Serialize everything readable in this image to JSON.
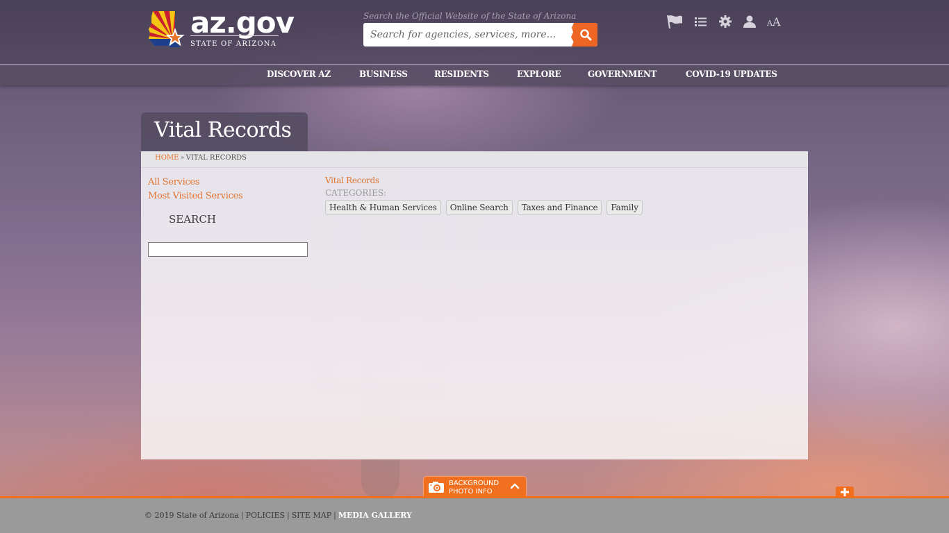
{
  "header": {
    "logo_word": "az.gov",
    "logo_subtitle": "STATE OF ARIZONA",
    "search_label": "Search the Official Website of the State of Arizona",
    "search_placeholder": "Search for agencies, services, more...",
    "search_value": "",
    "utility_icons": [
      "flag-icon",
      "list-icon",
      "gear-icon",
      "user-icon",
      "font-size-icon"
    ],
    "font_size_small": "A",
    "font_size_large": "A"
  },
  "nav": {
    "items": [
      {
        "label": "DISCOVER AZ"
      },
      {
        "label": "BUSINESS"
      },
      {
        "label": "RESIDENTS"
      },
      {
        "label": "EXPLORE"
      },
      {
        "label": "GOVERNMENT"
      },
      {
        "label": "COVID-19 UPDATES"
      }
    ]
  },
  "page": {
    "title": "Vital Records",
    "breadcrumb": {
      "home": "HOME",
      "separator": "»",
      "current": "VITAL RECORDS"
    }
  },
  "sidebar": {
    "links": [
      {
        "label": "All Services"
      },
      {
        "label": "Most Visited Services"
      }
    ],
    "search_heading": "SEARCH",
    "search_value": ""
  },
  "content": {
    "service_link": "Vital Records",
    "categories_label": "CATEGORIES:",
    "tags": [
      {
        "label": "Health & Human Services"
      },
      {
        "label": "Online Search"
      },
      {
        "label": "Taxes and Finance"
      },
      {
        "label": "Family"
      }
    ]
  },
  "photo_info": {
    "line1": "BACKGROUND",
    "line2": "PHOTO INFO"
  },
  "footer": {
    "copyright": "© 2019 State of Arizona",
    "links": [
      {
        "label": "POLICIES"
      },
      {
        "label": "SITE MAP"
      },
      {
        "label": "MEDIA GALLERY"
      }
    ],
    "separator": "|"
  },
  "colors": {
    "accent_orange": "#ee6624",
    "link_orange": "#e07634",
    "header_purple": "#544a62",
    "footer_gray": "#9a9a9a"
  }
}
